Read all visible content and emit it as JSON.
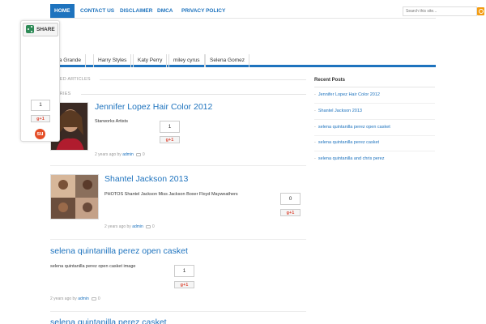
{
  "nav": {
    "items": [
      "HOME",
      "CONTACT US",
      "DISCLAIMER",
      "DMCA",
      "PRIVACY POLICY"
    ],
    "search_placeholder": "Search this site..."
  },
  "tags": [
    "riana Grande",
    "Harry Styles",
    "Katy Perry",
    "miley cyrus",
    "Selena Gomez"
  ],
  "featured_head": "TURED ARTICLES",
  "stories_head": "STORIES",
  "posts": [
    {
      "title": "Jennifer Lopez Hair Color 2012",
      "excerpt": "Starworks Artists",
      "meta_age": "2 years ago by",
      "meta_author": "admin",
      "meta_comments": "0",
      "count": "1",
      "gplus": "g+1"
    },
    {
      "title": "Shantel Jackson 2013",
      "excerpt": "PHOTOS Shantel Jackson Miss Jackson Boxer Floyd Mayweathers",
      "meta_age": "2 years ago by",
      "meta_author": "admin",
      "meta_comments": "0",
      "count": "0",
      "gplus": "g+1"
    },
    {
      "title": "selena quintanilla perez open casket",
      "excerpt": "selena quintanilla perez open casket image",
      "meta_age": "2 years ago by",
      "meta_author": "admin",
      "meta_comments": "0",
      "count": "1",
      "gplus": "g+1"
    },
    {
      "title": "selena quintanilla perez casket"
    }
  ],
  "sidebar": {
    "title": "Recent Posts",
    "items": [
      "Jennifer Lopez Hair Color 2012",
      "Shantel Jackson 2013",
      "selena quintanilla perez open casket",
      "selena quintanilla perez casket",
      "selena quintanilla and chris perez"
    ]
  },
  "share_widget": {
    "label": "SHARE",
    "count": "1",
    "gplus": "g+1",
    "stumble": "su"
  },
  "colors": {
    "accent": "#1e73be",
    "share_green": "#2e8b57",
    "stumble_orange": "#e44d26",
    "search_orange": "#f39c12"
  }
}
